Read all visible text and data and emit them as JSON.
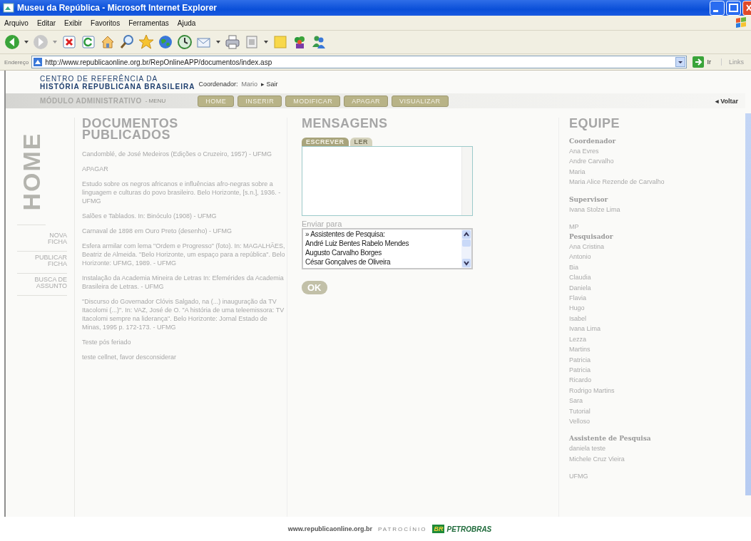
{
  "window": {
    "title": "Museu da República - Microsoft Internet Explorer"
  },
  "menu": [
    "Arquivo",
    "Editar",
    "Exibir",
    "Favoritos",
    "Ferramentas",
    "Ajuda"
  ],
  "address": {
    "label": "Endereço",
    "url": "http://www.republicaonline.org.br/RepOnlineAPP/documentos/index.asp",
    "go": "Ir",
    "links": "Links"
  },
  "header": {
    "logo_top": "CENTRO DE REFERÊNCIA DA",
    "logo_bottom": "HISTÓRIA REPUBLICANA BRASILEIRA",
    "user_label": "Coordenador:",
    "user": "Mario",
    "logout": "▸ Sair"
  },
  "nav": {
    "module": "MÓDULO ADMINISTRATIVO",
    "menu": "- MENU",
    "buttons": [
      "HOME",
      "INSERIR",
      "MODIFICAR",
      "APAGAR",
      "VISUALIZAR"
    ],
    "back": "◂ Voltar"
  },
  "sidebar": {
    "section": "HOME",
    "links": [
      {
        "lines": [
          "NOVA",
          "FICHA"
        ]
      },
      {
        "lines": [
          "PUBLICAR",
          "FICHA"
        ]
      },
      {
        "lines": [
          "BUSCA DE",
          "ASSUNTO"
        ]
      }
    ]
  },
  "documents": {
    "title": "DOCUMENTOS PUBLICADOS",
    "items": [
      {
        "text": "Candomblé, de José Medeiros (Edições o Cruzeiro, 1957) - UFMG"
      },
      {
        "text": "APAGAR"
      },
      {
        "text": "Estudo sobre os negros africanos e influências afro-negras sobre a linguagem e culturas do povo brasileiro. Belo Horizonte, [s.n.], 1936. - UFMG"
      },
      {
        "text": "Salões e Tablados. In: Binóculo (1908) - UFMG"
      },
      {
        "text": "Carnaval de 1898 em Ouro Preto (desenho) - UFMG"
      },
      {
        "text": "Esfera armilar com lema \"Ordem e Progresso\" (foto). In: MAGALHÃES, Beatriz de Almeida. \"Belo Horizonte, um espaço para a república\". Belo Horizonte: UFMG, 1989. - UFMG"
      },
      {
        "text": "Instalação da Academia Mineira de Letras In: Efemérides da Academia Brasileira de Letras. - UFMG"
      },
      {
        "text": "\"Discurso do Governador Clóvis Salgado, na (...) inauguração da TV Itacolomi (...)\". In: VAZ, José de O. \"A história de uma teleemissora: TV Itacolomi sempre na liderança\". Belo Horizonte: Jornal Estado de Minas, 1995 p. 172-173. - UFMG"
      },
      {
        "text": "Teste pós feriado"
      },
      {
        "text": "teste cellnet, favor desconsiderar"
      }
    ]
  },
  "messages": {
    "title": "MENSAGENS",
    "tabs": [
      {
        "label": "ESCREVER",
        "selected": true
      },
      {
        "label": "LER",
        "selected": false
      }
    ],
    "send_label": "Enviar para",
    "recipients": [
      "» Assistentes de Pesquisa:",
      "André Luiz Bentes Rabelo Mendes",
      "Augusto Carvalho Borges",
      "César Gonçalves de Oliveira"
    ],
    "ok": "OK"
  },
  "team": {
    "title": "EQUIPE",
    "groups": [
      {
        "heading": "Coordenador",
        "members": [
          "Ana Evres",
          "Andre Carvalho",
          "Maria",
          "Maria Alice Rezende de Carvalho"
        ]
      },
      {
        "heading": "Supervisor",
        "members": [
          "Ivana Stolze Lima"
        ]
      },
      {
        "tag": "MP",
        "heading": "Pesquisador",
        "members": [
          "Ana Cristina",
          "Antonio",
          "Bia",
          "Claudia",
          "Daniela",
          "Flavia",
          "Hugo",
          "Isabel",
          "Ivana Lima",
          "Lezza",
          "Martins",
          "Patricia",
          "Patricia",
          "Ricardo",
          "Rodrigo Martins",
          "Sara",
          "Tutorial",
          "Velloso"
        ]
      },
      {
        "heading": "Assistente de Pesquisa",
        "members": [
          "daniela teste",
          "Michele Cruz Vieira"
        ]
      },
      {
        "tag": "UFMG"
      }
    ]
  },
  "footer": {
    "site": "www.republicaonline.org.br",
    "sponsor_label": "PATROCÍNIO",
    "sponsor_mark": "BR",
    "sponsor": "PETROBRAS"
  }
}
